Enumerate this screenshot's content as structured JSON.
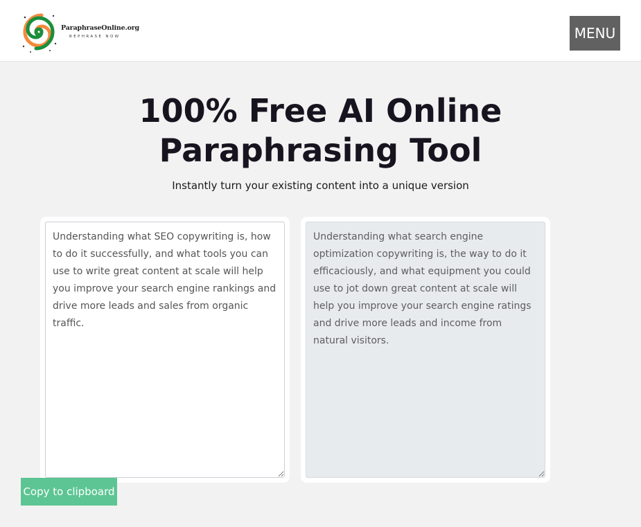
{
  "header": {
    "logo": {
      "name": "ParaphraseOnline.org",
      "tagline": "REPHRASE NOW",
      "colors": [
        "#f28a3e",
        "#1a8f3c"
      ]
    },
    "menu_label": "MENU"
  },
  "main": {
    "title": "100% Free AI Online Paraphrasing Tool",
    "subtitle": "Instantly turn your existing content into a unique version",
    "input_text": "Understanding what SEO copywriting is, how to do it successfully, and what tools you can use to write great content at scale will help you improve your search engine rankings and drive more leads and sales from organic traffic.",
    "output_text": "Understanding what search engine optimization copywriting is, the way to do it efficaciously, and what equipment you could use to jot down great content at scale will help you improve your search engine ratings and drive more leads and income from natural visitors.",
    "copy_label": "Copy to clipboard"
  },
  "colors": {
    "page_background": "#f2f2f2",
    "menu_button": "#616161",
    "copy_button": "#5cc593",
    "output_background": "#e8ebee"
  }
}
